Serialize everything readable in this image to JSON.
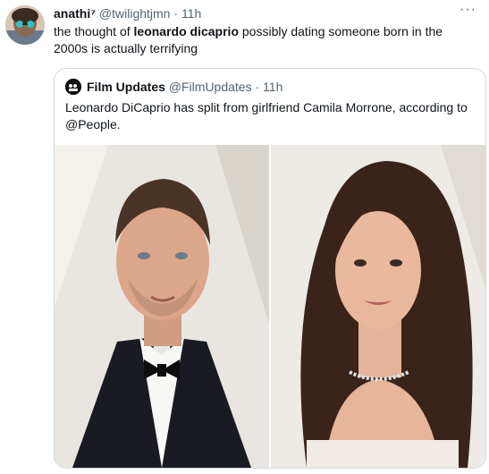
{
  "author": {
    "display_name": "anathi⁷",
    "handle": "@twilightjmn",
    "separator": "·",
    "time": "11h"
  },
  "more_icon": "more-icon",
  "tweet": {
    "text_pre": "the thought of ",
    "text_bold": "leonardo dicaprio",
    "text_post": " possibly dating someone born in the 2000s is actually terrifying"
  },
  "quoted": {
    "display_name": "Film Updates",
    "handle": "@FilmUpdates",
    "separator": "·",
    "time": "11h",
    "text": "Leonardo DiCaprio has split from girlfriend Camila Morrone, according to @People."
  },
  "colors": {
    "text": "#0f1419",
    "secondary": "#536471",
    "border": "#cfd9de"
  }
}
